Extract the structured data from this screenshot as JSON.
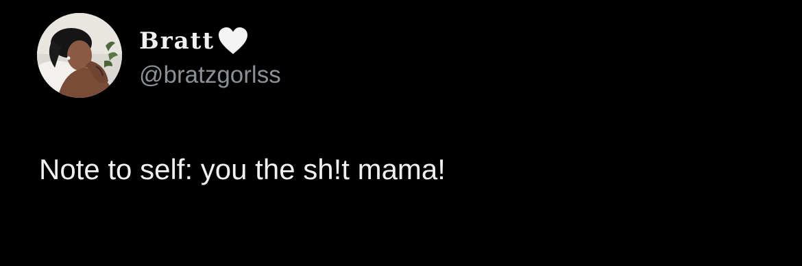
{
  "author": {
    "display_name": "Bratt",
    "badge_icon": "white-heart-icon",
    "handle": "@bratzgorlss",
    "avatar_icon": "profile-photo"
  },
  "tweet": {
    "text": "Note to self: you the sh!t mama!"
  },
  "colors": {
    "background": "#000000",
    "primary_text": "#e7e9ea",
    "secondary_text": "#8b9096"
  }
}
